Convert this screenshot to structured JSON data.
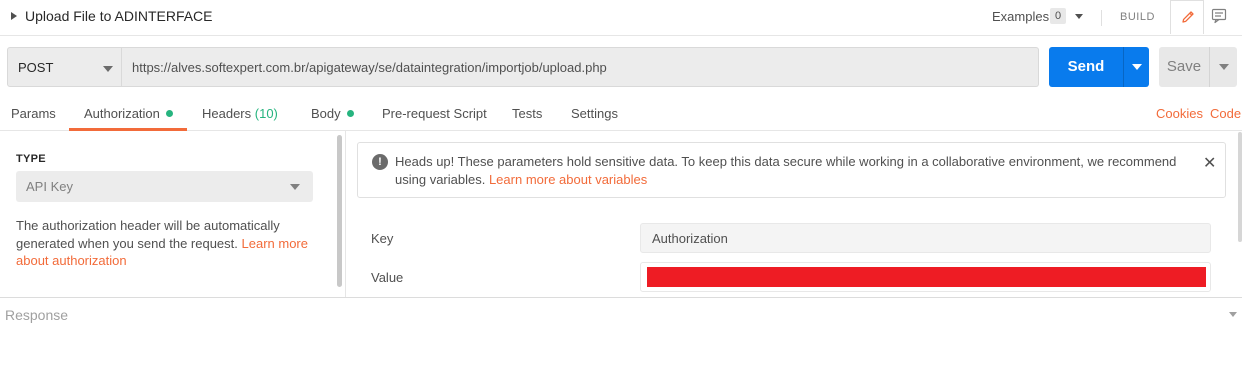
{
  "request": {
    "name": "Upload File to ADINTERFACE",
    "examples_label": "Examples",
    "examples_count": "0",
    "build_label": "BUILD",
    "method": "POST",
    "url": "https://alves.softexpert.com.br/apigateway/se/dataintegration/importjob/upload.php",
    "send_label": "Send",
    "save_label": "Save"
  },
  "tabs": {
    "params": "Params",
    "authorization": "Authorization",
    "headers": "Headers",
    "headers_count": "(10)",
    "body": "Body",
    "prerequest": "Pre-request Script",
    "tests": "Tests",
    "settings": "Settings",
    "cookies": "Cookies",
    "code": "Code"
  },
  "auth": {
    "type_label": "TYPE",
    "type_value": "API Key",
    "description": "The authorization header will be automatically generated when you send the request. ",
    "learn_more_link": "Learn more about authorization",
    "alert_text": "Heads up! These parameters hold sensitive data. To keep this data secure while working in a collaborative environment, we recommend using variables. ",
    "alert_link": "Learn more about variables",
    "alert_close": "✕",
    "key_label": "Key",
    "key_value": "Authorization",
    "value_label": "Value"
  },
  "response": {
    "label": "Response"
  },
  "icons": {
    "expand": "caret-right-icon",
    "edit": "pencil-icon",
    "comments": "comment-icon",
    "alert": "exclamation-icon"
  },
  "colors": {
    "accent_orange": "#f26b3a",
    "send_blue": "#097bed",
    "status_green": "#26b47f",
    "redaction": "#ee1c24"
  }
}
